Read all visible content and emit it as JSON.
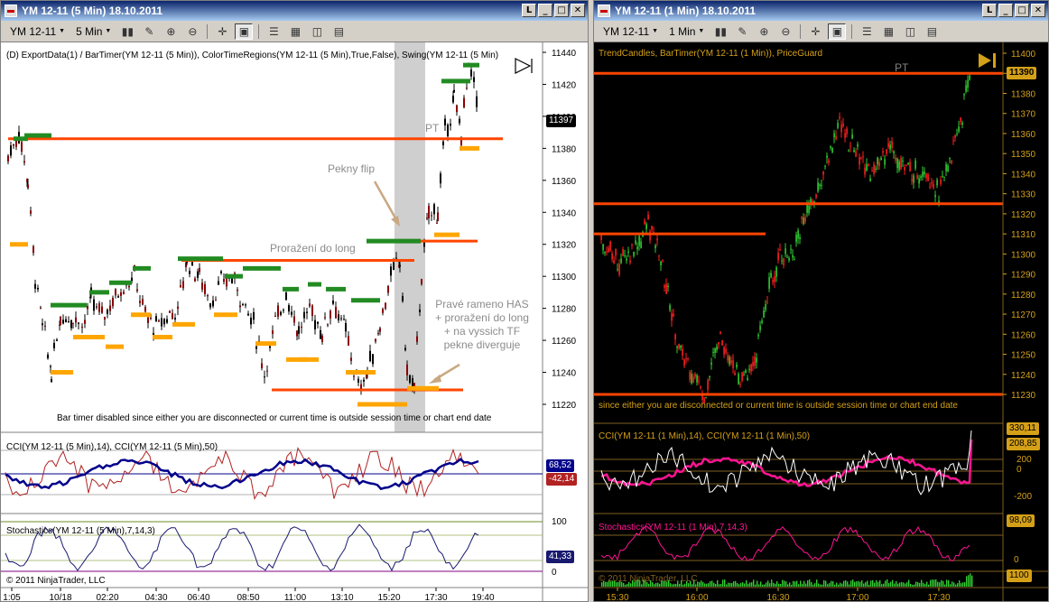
{
  "left": {
    "title": "YM 12-11 (5 Min)  18.10.2011",
    "instrument": "YM 12-11",
    "interval": "5 Min",
    "indicators_label": "(D) ExportData(1) / BarTimer(YM 12-11 (5 Min)), ColorTimeRegions(YM 12-11 (5 Min),True,False), Swing(YM 12-11 (5 Min)",
    "price_ticks": [
      "11440",
      "11420",
      "11400",
      "11380",
      "11360",
      "11340",
      "11320",
      "11300",
      "11280",
      "11260",
      "11240",
      "11220"
    ],
    "last_price": "11397",
    "annotations": {
      "pt": "PT",
      "flip": "Pekny flip",
      "breakout": "Proražení do long",
      "right_shoulder": [
        "Pravé rameno HAS",
        "+ proražení do long",
        "+ na vyssich TF",
        "pekne diverguje"
      ]
    },
    "bar_timer_msg": "Bar timer disabled since either you are disconnected or current time is outside session time or chart end date",
    "cci_label": "CCI(YM 12-11 (5 Min),14), CCI(YM 12-11 (5 Min),50)",
    "cci_values": [
      "68,52",
      "-42,14"
    ],
    "stoch_label": "Stochastics(YM 12-11 (5 Min),7,14,3)",
    "stoch_ticks": [
      "100",
      "0"
    ],
    "stoch_value": "41,33",
    "copyright": "© 2011 NinjaTrader, LLC",
    "time_ticks": [
      "1:05",
      "10/18",
      "02:20",
      "04:30",
      "06:40",
      "08:50",
      "11:00",
      "13:10",
      "15:20",
      "17:30",
      "19:40"
    ]
  },
  "right": {
    "title": "YM 12-11 (1 Min)  18.10.2011",
    "instrument": "YM 12-11",
    "interval": "1 Min",
    "indicators_label": "TrendCandles, BarTimer(YM 12-11 (1 Min)), PriceGuard",
    "price_ticks": [
      "11400",
      "11390",
      "11380",
      "11370",
      "11360",
      "11350",
      "11340",
      "11330",
      "11320",
      "11310",
      "11300",
      "11290",
      "11280",
      "11270",
      "11260",
      "11250",
      "11240",
      "11230"
    ],
    "last_price": "11390",
    "pt": "PT",
    "session_msg": "since either you are disconnected or current time is outside session time or chart end date",
    "cci_label": "CCI(YM 12-11 (1 Min),14), CCI(YM 12-11 (1 Min),50)",
    "cci_values": [
      "330,11",
      "208,85"
    ],
    "cci_ticks": [
      "200",
      "0",
      "-200"
    ],
    "stoch_label": "Stochastics(YM 12-11 (1 Min),7,14,3)",
    "stoch_value": "98,09",
    "stoch_ticks": [
      "0"
    ],
    "volume_value": "1100",
    "copyright": "© 2011 NinjaTrader, LLC",
    "time_ticks": [
      "15:30",
      "16:00",
      "16:30",
      "17:00",
      "17:30"
    ]
  },
  "colors": {
    "level_line": "#ff4500",
    "swing_high": "#228b22",
    "swing_low": "#ffa500",
    "cci_fast": "#b22222",
    "cci_slow": "#00008b",
    "stoch": "#191970",
    "pink": "#ff1493"
  },
  "toolbar_icons": [
    "bar-type-icon",
    "pencil-icon",
    "zoom-in-icon",
    "zoom-out-icon",
    "crosshair-icon",
    "data-box-icon",
    "properties-icon",
    "strategy-icon",
    "indicator-icon",
    "template-icon"
  ]
}
